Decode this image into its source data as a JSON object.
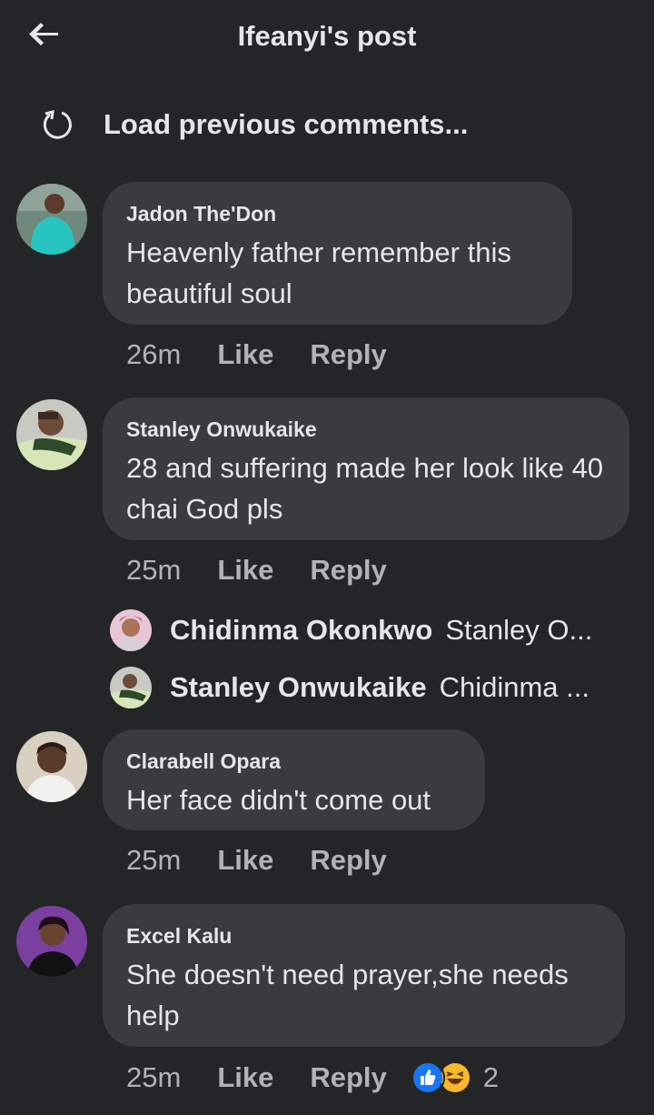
{
  "header": {
    "title": "Ifeanyi's post",
    "back_icon": "arrow-left-icon"
  },
  "load_previous": {
    "label": "Load previous comments...",
    "icon": "refresh-icon"
  },
  "colors": {
    "background": "#242526",
    "bubble": "#3a3b3c",
    "text": "#e4e6eb",
    "muted": "#b0b3b8",
    "like_blue": "#1877f2",
    "haha_yellow": "#f7b928"
  },
  "comments": [
    {
      "author": "Jadon The'Don",
      "text": "Heavenly father remember this beautiful soul",
      "time": "26m",
      "like_label": "Like",
      "reply_label": "Reply"
    },
    {
      "author": "Stanley Onwukaike",
      "text": "28 and suffering made her look like 40 chai God pls",
      "time": "25m",
      "like_label": "Like",
      "reply_label": "Reply",
      "replies": [
        {
          "author": "Chidinma Okonkwo",
          "preview": "Stanley O..."
        },
        {
          "author": "Stanley Onwukaike",
          "preview": "Chidinma ..."
        }
      ]
    },
    {
      "author": "Clarabell Opara",
      "text": "Her face didn't come out",
      "time": "25m",
      "like_label": "Like",
      "reply_label": "Reply"
    },
    {
      "author": "Excel Kalu",
      "text": "She doesn't need prayer,she needs help",
      "time": "25m",
      "like_label": "Like",
      "reply_label": "Reply",
      "reactions": {
        "icons": [
          "like-reaction-icon",
          "haha-reaction-icon"
        ],
        "count": "2"
      }
    }
  ]
}
